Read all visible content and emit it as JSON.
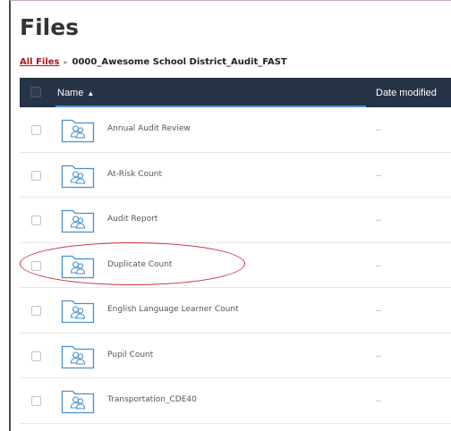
{
  "page": {
    "title": "Files"
  },
  "breadcrumb": {
    "root": "All Files",
    "separator": "▸",
    "current": "0000_Awesome School District_Audit_FAST"
  },
  "table": {
    "columns": {
      "name": "Name",
      "date_modified": "Date modified"
    },
    "sort_indicator": "▲",
    "rows": [
      {
        "name": "Annual Audit Review",
        "date": "--"
      },
      {
        "name": "At-Risk Count",
        "date": "--"
      },
      {
        "name": "Audit Report",
        "date": "--"
      },
      {
        "name": "Duplicate Count",
        "date": "--"
      },
      {
        "name": "English Language Learner Count",
        "date": "--"
      },
      {
        "name": "Pupil Count",
        "date": "--"
      },
      {
        "name": "Transportation_CDE40",
        "date": "--"
      }
    ],
    "highlighted_row": "Duplicate Count"
  },
  "colors": {
    "header_bg": "#273346",
    "link_red": "#b1121b",
    "accent_blue": "#4d8fd6",
    "annotation_red": "#c92b39"
  },
  "icons": {
    "folder": "shared-folder-icon",
    "sort": "sort-ascending-icon"
  }
}
